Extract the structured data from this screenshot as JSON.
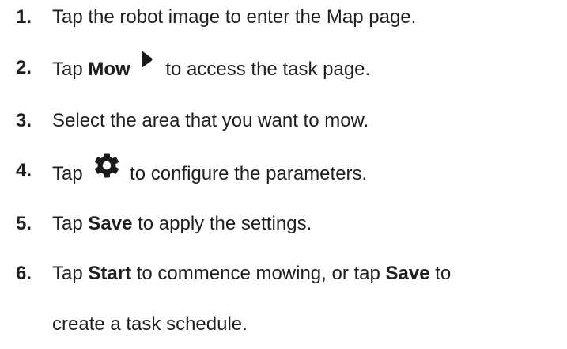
{
  "steps": [
    {
      "number": "1.",
      "text": "Tap the robot image to enter the Map page."
    },
    {
      "number": "2.",
      "pre": "Tap ",
      "bold": "Mow",
      "post": " to access the task page.",
      "icon": "play-icon"
    },
    {
      "number": "3.",
      "text": "Select the area that you want to mow."
    },
    {
      "number": "4.",
      "pre": "Tap ",
      "post": " to configure the parameters.",
      "icon": "gear-icon"
    },
    {
      "number": "5.",
      "pre": "Tap ",
      "bold": "Save",
      "post": " to apply the settings."
    },
    {
      "number": "6.",
      "pre": "Tap ",
      "bold1": "Start",
      "mid": " to commence mowing, or tap ",
      "bold2": "Save",
      "post": " to",
      "continuation": "create a task schedule."
    }
  ],
  "colors": {
    "text": "#1f1f1f",
    "icon": "#1a1a1a"
  }
}
